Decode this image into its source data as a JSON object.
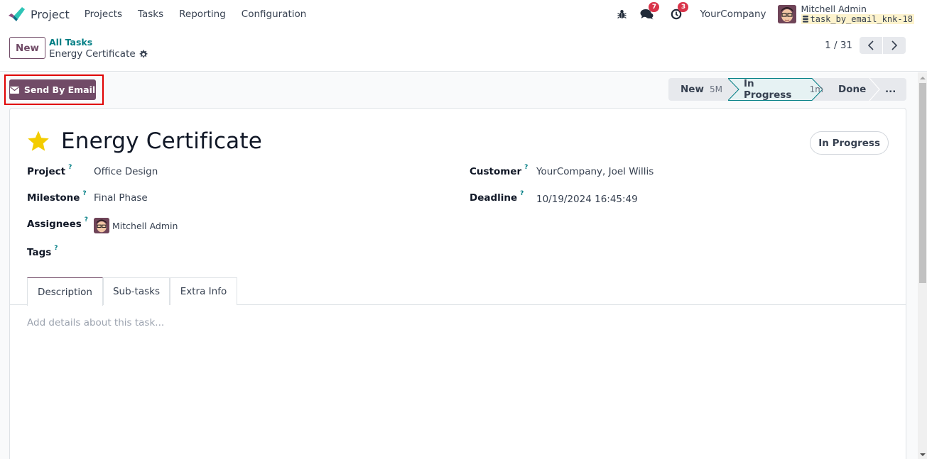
{
  "navbar": {
    "app_name": "Project",
    "menu": [
      "Projects",
      "Tasks",
      "Reporting",
      "Configuration"
    ],
    "icons": [
      "bug-icon",
      "chat-icon",
      "clock-icon"
    ],
    "messages_badge": "7",
    "activities_badge": "3",
    "company": "YourCompany",
    "user_name": "Mitchell Admin",
    "database": "task_by_email_knk-18"
  },
  "control_panel": {
    "new_label": "New",
    "breadcrumb_parent": "All Tasks",
    "breadcrumb_current": "Energy Certificate",
    "pager_value": "1 / 31"
  },
  "statusbar": {
    "send_email_label": "Send By Email",
    "stages": [
      {
        "label": "New",
        "duration": "5M"
      },
      {
        "label": "In Progress",
        "duration": "1m",
        "current": true
      },
      {
        "label": "Done",
        "duration": ""
      },
      {
        "label": "...",
        "duration": ""
      }
    ]
  },
  "task": {
    "title": "Energy Certificate",
    "starred": true,
    "state": "In Progress",
    "fields_left": [
      {
        "label": "Project",
        "value": "Office Design"
      },
      {
        "label": "Milestone",
        "value": "Final Phase"
      },
      {
        "label": "Assignees",
        "value": "Mitchell Admin"
      },
      {
        "label": "Tags",
        "value": ""
      }
    ],
    "fields_right": [
      {
        "label": "Customer",
        "value": "YourCompany, Joel Willis"
      },
      {
        "label": "Deadline",
        "value": "10/19/2024 16:45:49"
      }
    ],
    "help_marker": "?",
    "tabs": [
      "Description",
      "Sub-tasks",
      "Extra Info"
    ],
    "active_tab": "Description",
    "description_placeholder": "Add details about this task..."
  },
  "colors": {
    "brand": "#714B67",
    "link": "#017e84",
    "star": "#f3cc00",
    "highlight": "#e00000"
  }
}
